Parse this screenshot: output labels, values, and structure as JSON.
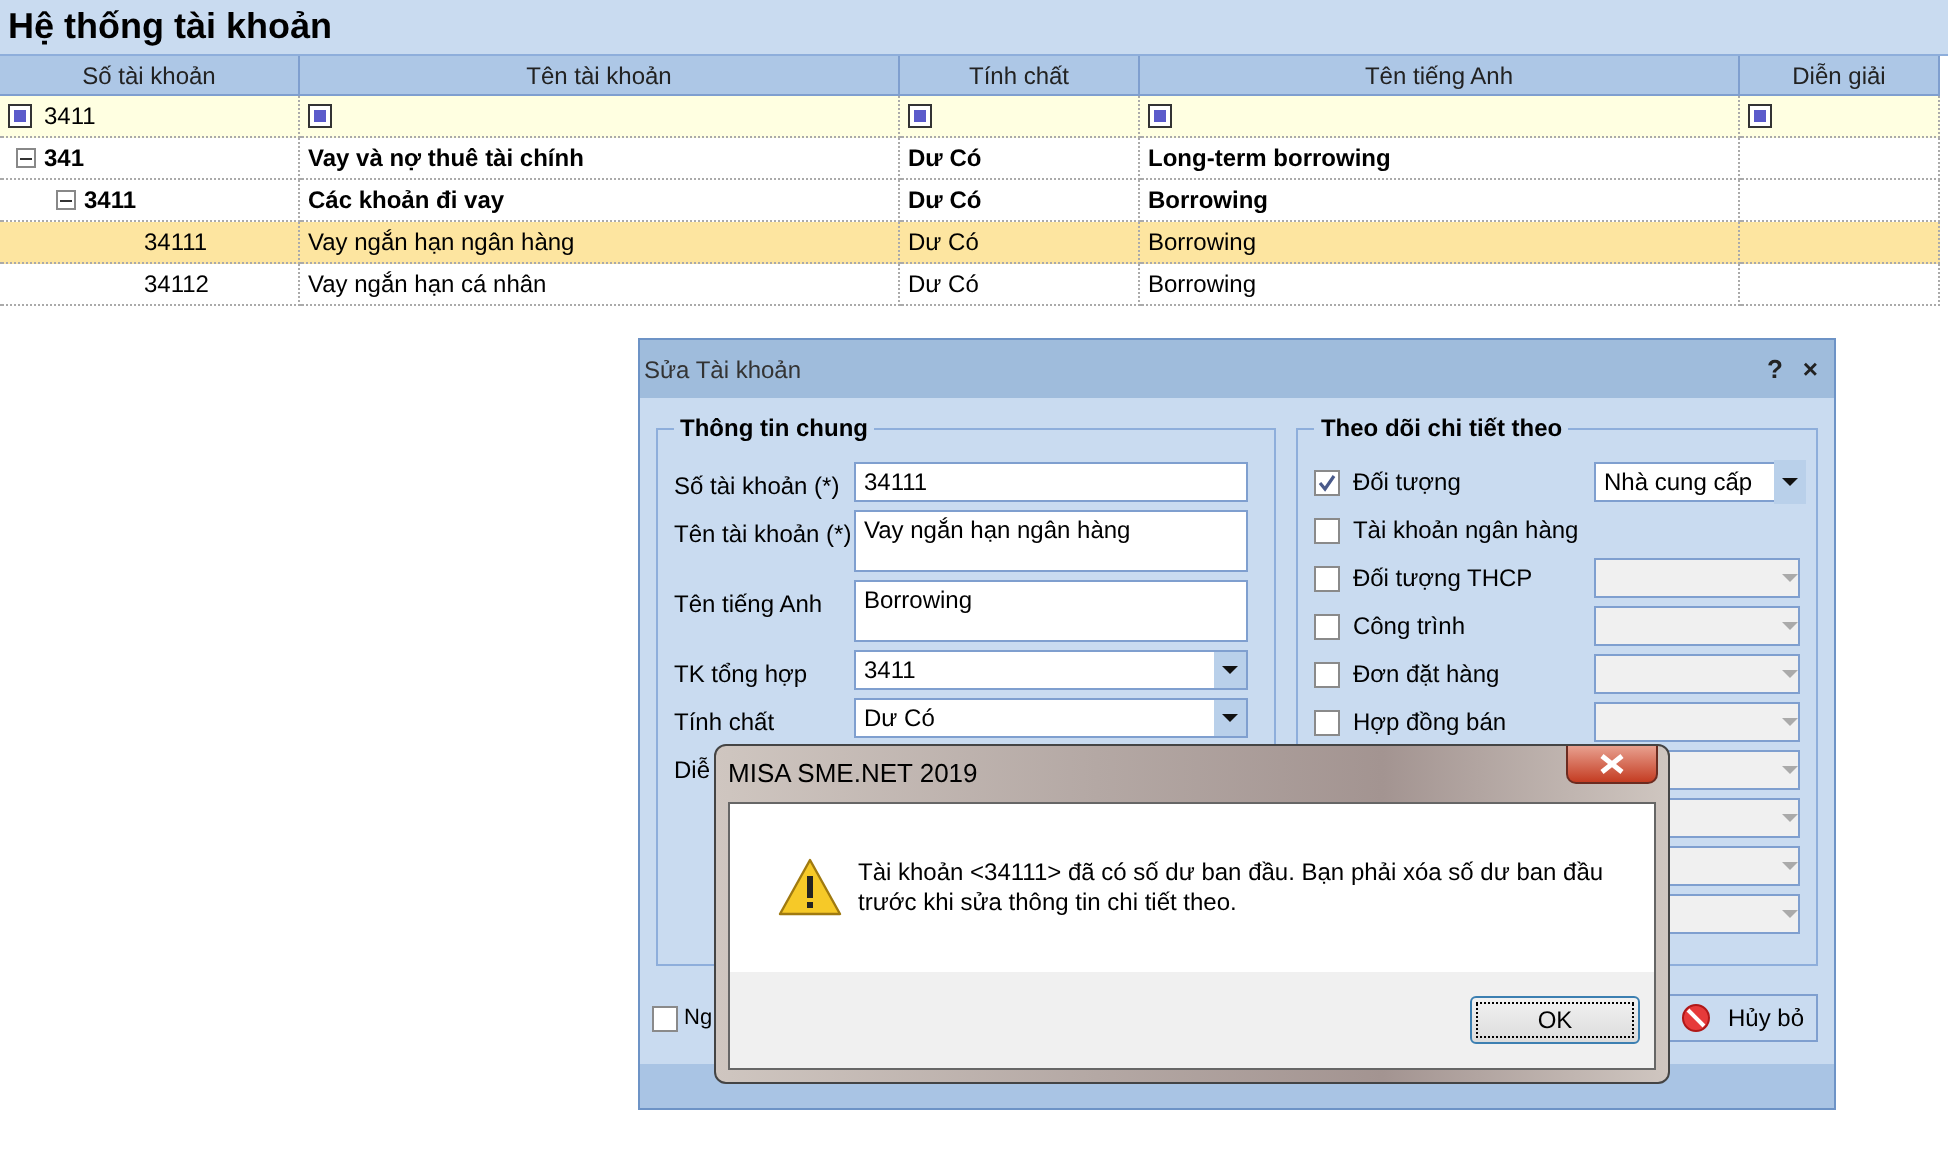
{
  "page_title": "Hệ thống tài khoản",
  "table": {
    "columns": [
      {
        "label": "Số tài khoản",
        "filter": "3411"
      },
      {
        "label": "Tên tài khoản"
      },
      {
        "label": "Tính chất"
      },
      {
        "label": "Tên tiếng Anh"
      },
      {
        "label": "Diễn giải"
      }
    ],
    "rows": [
      {
        "account": "341",
        "name": "Vay và nợ thuê tài chính",
        "nature": "Dư Có",
        "english": "Long-term borrowing",
        "expanded": true,
        "selected": false,
        "children": [
          {
            "account": "3411",
            "name": "Các khoản đi vay",
            "nature": "Dư Có",
            "english": "Borrowing",
            "expanded": true,
            "selected": false,
            "children": [
              {
                "account": "34111",
                "name": "Vay ngắn hạn ngân hàng",
                "nature": "Dư Có",
                "english": "Borrowing",
                "selected": true
              },
              {
                "account": "34112",
                "name": "Vay ngắn hạn cá nhân",
                "nature": "Dư Có",
                "english": "Borrowing",
                "selected": false
              }
            ]
          }
        ]
      }
    ]
  },
  "edit_dialog": {
    "title": "Sửa Tài khoản",
    "help": "?",
    "close": "×",
    "general": {
      "legend": "Thông tin chung",
      "fields": [
        {
          "label": "Số tài khoản (*)",
          "value": "34111",
          "kind": "text"
        },
        {
          "label": "Tên tài khoản (*)",
          "value": "Vay ngắn hạn ngân hàng",
          "kind": "textarea"
        },
        {
          "label": "Tên tiếng Anh",
          "value": "Borrowing",
          "kind": "textarea"
        },
        {
          "label": "TK tổng hợp",
          "value": "3411",
          "kind": "dropdown"
        },
        {
          "label": "Tính chất",
          "value": "Dư Có",
          "kind": "dropdown"
        },
        {
          "label": "Diễ",
          "kind": "label_only"
        }
      ]
    },
    "tracking": {
      "legend": "Theo dõi chi tiết theo",
      "items": [
        {
          "kind": "dropdown",
          "label": "Đối tượng",
          "checked": true,
          "value": "Nhà cung cấp",
          "disabled": false
        },
        {
          "kind": "plain",
          "label": "Tài khoản ngân hàng",
          "checked": false
        },
        {
          "kind": "dropdown",
          "label": "Đối tượng THCP",
          "checked": false,
          "disabled": true
        },
        {
          "kind": "dropdown",
          "label": "Công trình",
          "checked": false,
          "disabled": true
        },
        {
          "kind": "dropdown",
          "label": "Đơn đặt hàng",
          "checked": false,
          "disabled": true
        },
        {
          "kind": "dropdown",
          "label": "Hợp đồng bán",
          "checked": false,
          "disabled": true
        },
        {
          "kind": "dropdown_only",
          "disabled": true
        },
        {
          "kind": "dropdown_only",
          "disabled": true
        },
        {
          "kind": "dropdown_only",
          "disabled": true
        },
        {
          "kind": "dropdown_only",
          "disabled": true
        }
      ]
    },
    "footer": {
      "checkbox": {
        "label": "Ng",
        "checked": false
      },
      "cancel_button": "Hủy bỏ"
    }
  },
  "message_box": {
    "title": "MISA SME.NET 2019",
    "message": "Tài khoản <34111> đã có số dư ban đầu. Bạn phải xóa số dư ban đầu trước khi sửa thông tin chi tiết theo.",
    "ok_button": "OK"
  }
}
